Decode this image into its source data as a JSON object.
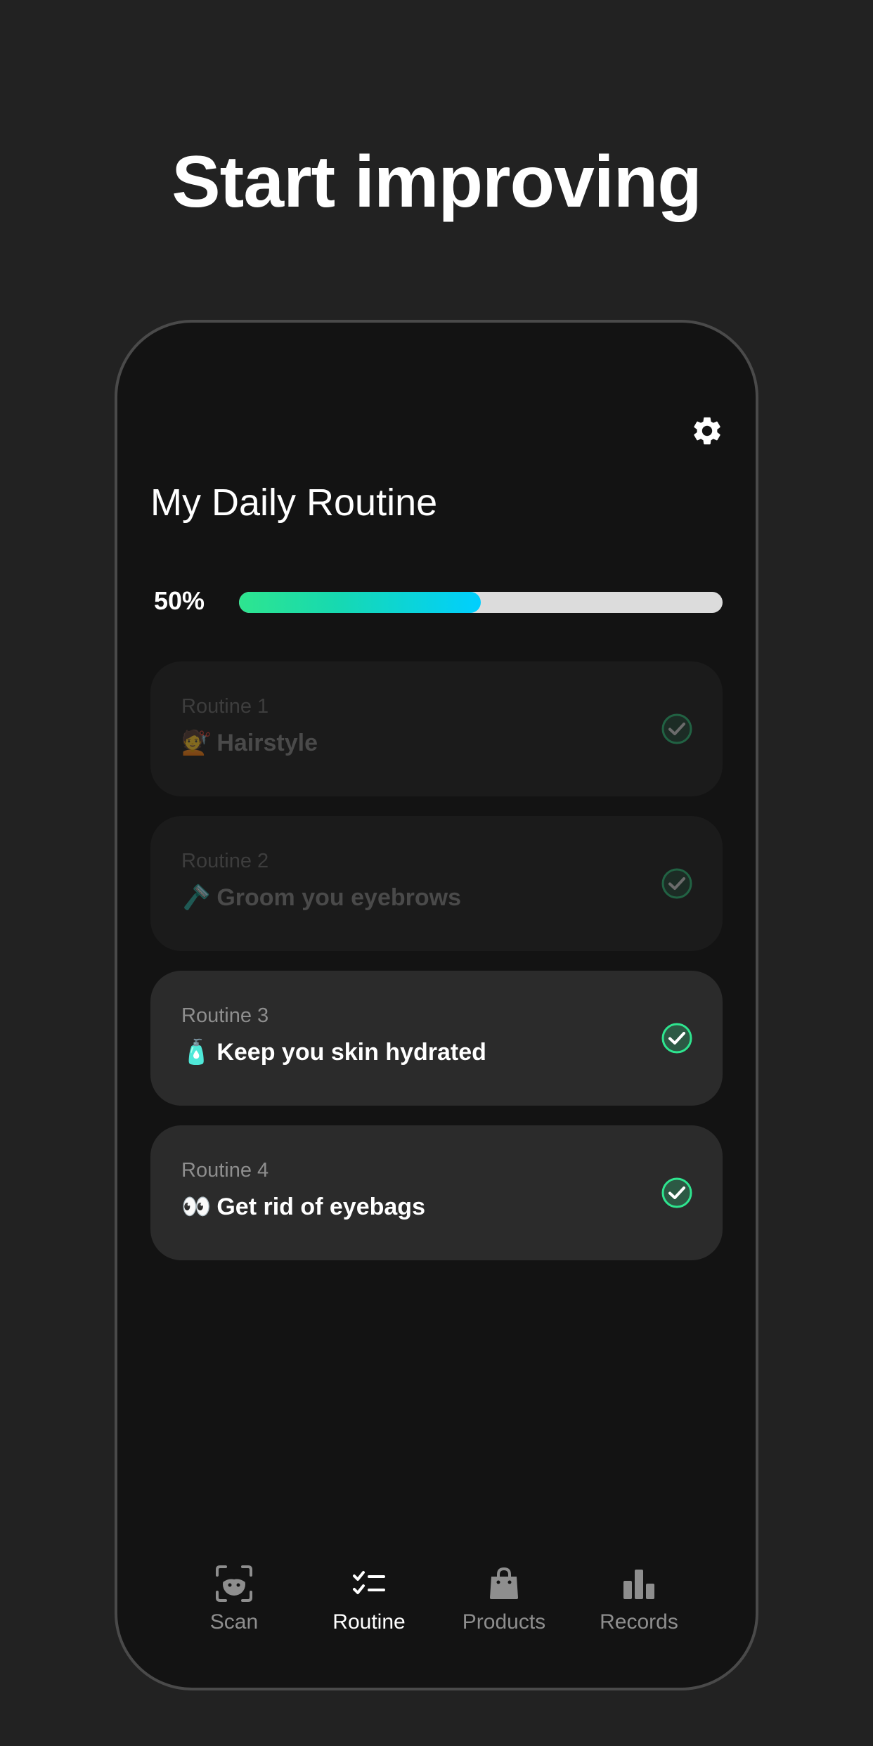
{
  "headline": "Start improving",
  "screen": {
    "title": "My Daily Routine",
    "settings_icon": "gear-icon"
  },
  "progress": {
    "label": "50%",
    "value": 0.5,
    "gradient_colors": [
      "#2ee58f",
      "#00cfff"
    ]
  },
  "routines": [
    {
      "number": "Routine 1",
      "emoji": "💇",
      "name": "Hairstyle",
      "completed": true,
      "dimmed": true
    },
    {
      "number": "Routine 2",
      "emoji": "🪒",
      "name": "Groom you eyebrows",
      "completed": true,
      "dimmed": true
    },
    {
      "number": "Routine 3",
      "emoji": "🧴",
      "name": "Keep you skin hydrated",
      "completed": true,
      "dimmed": false
    },
    {
      "number": "Routine 4",
      "emoji": "👀",
      "name": "Get rid of eyebags",
      "completed": true,
      "dimmed": false
    }
  ],
  "tabs": [
    {
      "label": "Scan",
      "icon": "face-scan-icon",
      "active": false
    },
    {
      "label": "Routine",
      "icon": "checklist-icon",
      "active": true
    },
    {
      "label": "Products",
      "icon": "shopping-bag-icon",
      "active": false
    },
    {
      "label": "Records",
      "icon": "bar-chart-icon",
      "active": false
    }
  ],
  "colors": {
    "background": "#222222",
    "phone_screen": "#131313",
    "card": "#2b2b2b",
    "card_dimmed": "#1b1b1b",
    "check_green": "#2ee58f"
  }
}
